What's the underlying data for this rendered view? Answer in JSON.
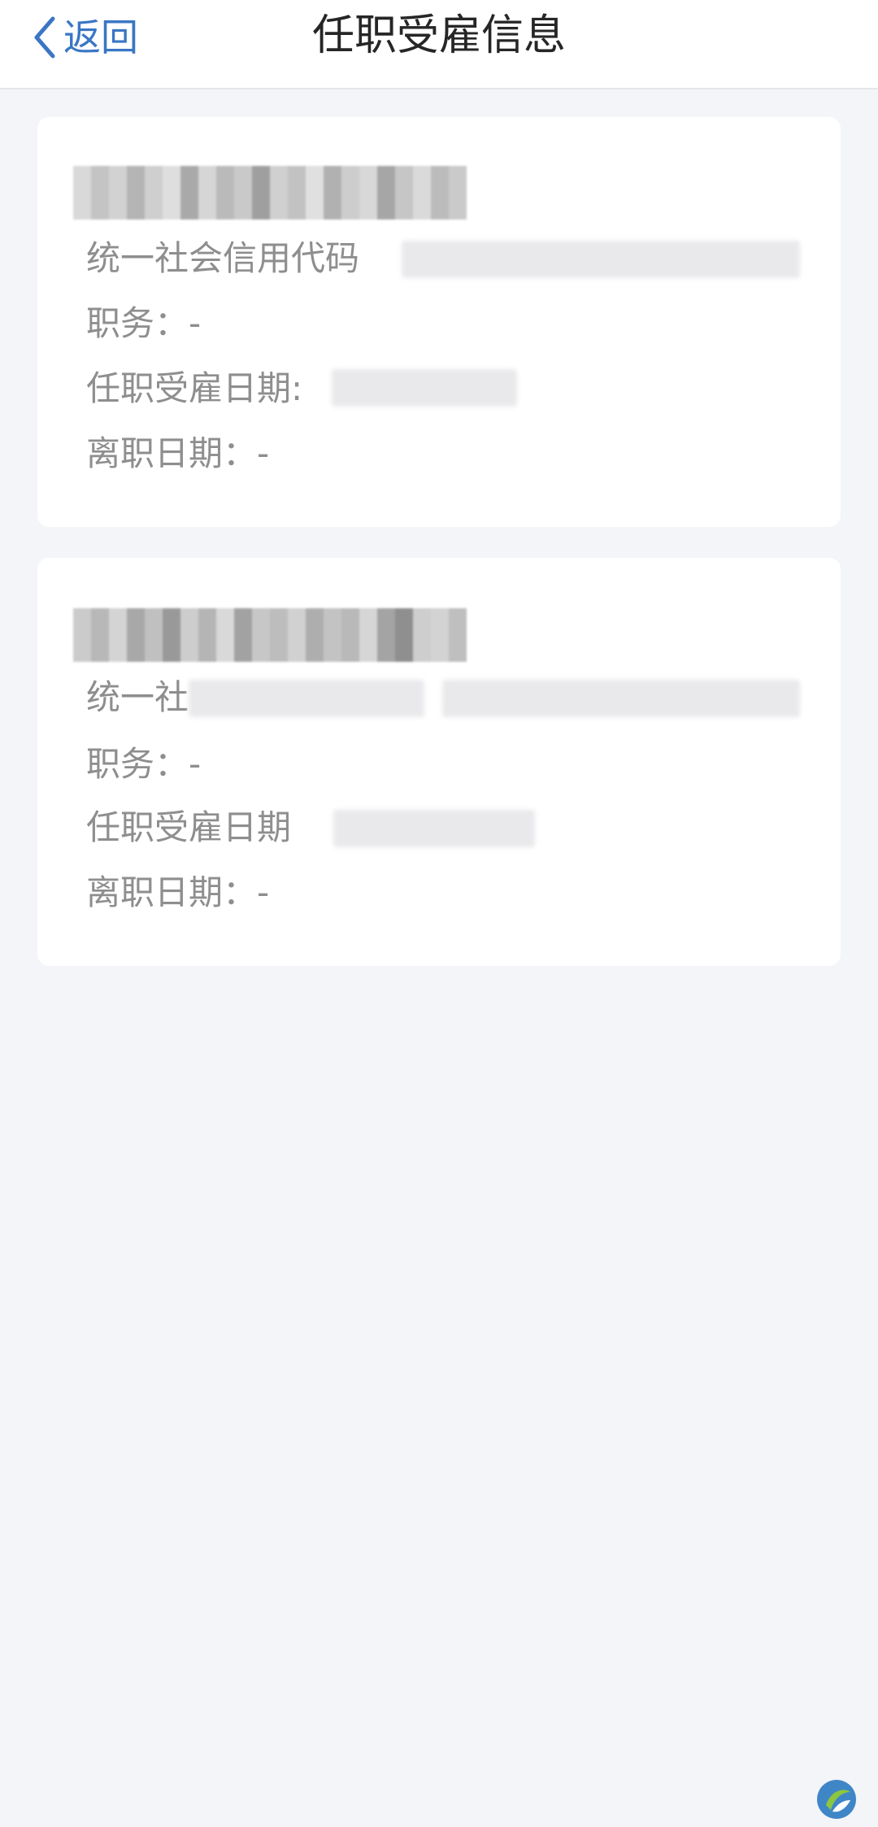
{
  "nav": {
    "back_label": "返回",
    "title": "任职受雇信息"
  },
  "records": [
    {
      "credit_code_label": "统一社会信用代码",
      "position_label": "职务：-",
      "start_date_label": "任职受雇日期:",
      "leave_date_label": "离职日期：-"
    },
    {
      "credit_code_label": "统一社",
      "position_label": "职务：-",
      "start_date_label": "任职受雇日期",
      "leave_date_label": "离职日期：-"
    }
  ],
  "colors": {
    "accent": "#3a76c4",
    "background": "#f4f5f9",
    "card": "#ffffff",
    "label_text": "#8e8e8e",
    "title_text": "#262626"
  },
  "icons": {
    "back": "chevron-left-icon",
    "watermark": "site-logo"
  }
}
